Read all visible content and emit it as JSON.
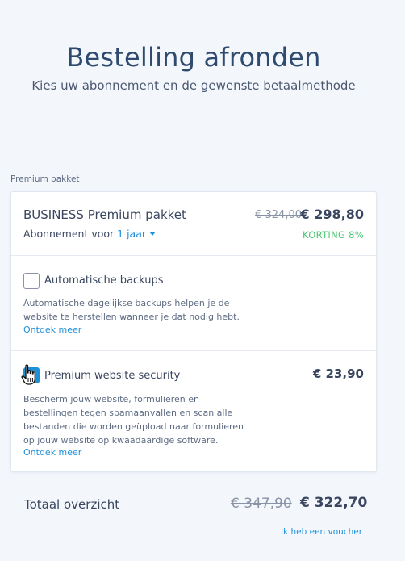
{
  "header": {
    "title": "Bestelling afronden",
    "subtitle": "Kies uw abonnement en de gewenste betaalmethode"
  },
  "section_label": "Premium pakket",
  "package": {
    "name": "BUSINESS Premium pakket",
    "old_price": "€ 324,00",
    "new_price": "€ 298,80",
    "subscription_label": "Abonnement voor",
    "subscription_period": "1 jaar",
    "discount": "KORTING 8%"
  },
  "options": [
    {
      "title": "Automatische backups",
      "description_line1": "Automatische dagelijkse backups helpen je de",
      "description_line2": "website te herstellen wanneer je dat nodig hebt.",
      "link": "Ontdek meer",
      "checked": false,
      "price": ""
    },
    {
      "title": "Premium website security",
      "description_line1": "Bescherm jouw website, formulieren en",
      "description_line2": "bestellingen tegen spamaanvallen en scan alle",
      "description_line3": "bestanden die worden geüpload naar formulieren",
      "description_line4": "op jouw website op kwaadaardige software.",
      "link": "Ontdek meer",
      "checked": true,
      "price": "€ 23,90"
    }
  ],
  "summary": {
    "label": "Totaal overzicht",
    "old_total": "€ 347,90",
    "new_total": "€ 322,70",
    "voucher_link": "Ik heb een voucher"
  },
  "colors": {
    "accent": "#1f8fd8",
    "discount_green": "#4cc874",
    "title_blue": "#2f4a6f",
    "background": "#f3f7fc"
  },
  "icons": {
    "cursor": "hand-pointer-icon",
    "dropdown": "caret-down-icon",
    "check": "checkmark-icon"
  }
}
